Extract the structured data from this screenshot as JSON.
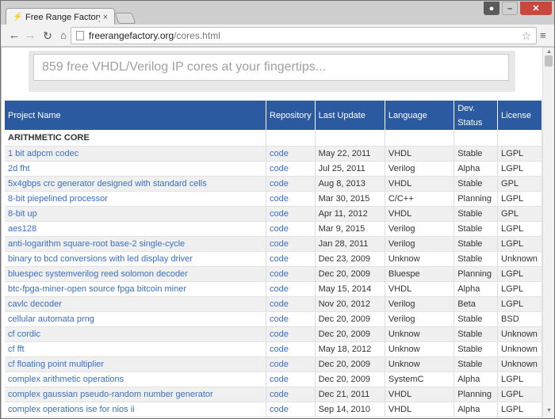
{
  "browser": {
    "tab_title": "Free Range Factory",
    "tab_close": "×",
    "url_host": "freerangefactory.org",
    "url_path": "/cores.html"
  },
  "search": {
    "placeholder": "859 free VHDL/Verilog IP cores at your fingertips..."
  },
  "table": {
    "headers": [
      "Project Name",
      "Repository",
      "Last Update",
      "Language",
      "Dev. Status",
      "License"
    ],
    "group": "ARITHMETIC CORE",
    "rows": [
      {
        "name": "1 bit adpcm codec",
        "repo": "code",
        "date": "May 22, 2011",
        "lang": "VHDL",
        "status": "Stable",
        "license": "LGPL"
      },
      {
        "name": "2d fht",
        "repo": "code",
        "date": "Jul 25, 2011",
        "lang": "Verilog",
        "status": "Alpha",
        "license": "LGPL"
      },
      {
        "name": "5x4gbps crc generator designed with standard cells",
        "repo": "code",
        "date": "Aug 8, 2013",
        "lang": "VHDL",
        "status": "Stable",
        "license": "GPL"
      },
      {
        "name": "8-bit piepelined processor",
        "repo": "code",
        "date": "Mar 30, 2015",
        "lang": "C/C++",
        "status": "Planning",
        "license": "LGPL"
      },
      {
        "name": "8-bit up",
        "repo": "code",
        "date": "Apr 11, 2012",
        "lang": "VHDL",
        "status": "Stable",
        "license": "GPL"
      },
      {
        "name": "aes128",
        "repo": "code",
        "date": "Mar 9, 2015",
        "lang": "Verilog",
        "status": "Stable",
        "license": "LGPL"
      },
      {
        "name": "anti-logarithm square-root base-2 single-cycle",
        "repo": "code",
        "date": "Jan 28, 2011",
        "lang": "Verilog",
        "status": "Stable",
        "license": "LGPL"
      },
      {
        "name": "binary to bcd conversions with led display driver",
        "repo": "code",
        "date": "Dec 23, 2009",
        "lang": "Unknow",
        "status": "Stable",
        "license": "Unknown"
      },
      {
        "name": "bluespec systemverilog reed solomon decoder",
        "repo": "code",
        "date": "Dec 20, 2009",
        "lang": "Bluespe",
        "status": "Planning",
        "license": "LGPL"
      },
      {
        "name": "btc-fpga-miner-open source fpga bitcoin miner",
        "repo": "code",
        "date": "May 15, 2014",
        "lang": "VHDL",
        "status": "Alpha",
        "license": "LGPL"
      },
      {
        "name": "cavlc decoder",
        "repo": "code",
        "date": "Nov 20, 2012",
        "lang": "Verilog",
        "status": "Beta",
        "license": "LGPL"
      },
      {
        "name": "cellular automata prng",
        "repo": "code",
        "date": "Dec 20, 2009",
        "lang": "Verilog",
        "status": "Stable",
        "license": "BSD"
      },
      {
        "name": "cf cordic",
        "repo": "code",
        "date": "Dec 20, 2009",
        "lang": "Unknow",
        "status": "Stable",
        "license": "Unknown"
      },
      {
        "name": "cf fft",
        "repo": "code",
        "date": "May 18, 2012",
        "lang": "Unknow",
        "status": "Stable",
        "license": "Unknown"
      },
      {
        "name": "cf floating point multiplier",
        "repo": "code",
        "date": "Dec 20, 2009",
        "lang": "Unknow",
        "status": "Stable",
        "license": "Unknown"
      },
      {
        "name": "complex arithmetic operations",
        "repo": "code",
        "date": "Dec 20, 2009",
        "lang": "SystemC",
        "status": "Alpha",
        "license": "LGPL"
      },
      {
        "name": "complex gaussian pseudo-random number generator",
        "repo": "code",
        "date": "Dec 21, 2011",
        "lang": "VHDL",
        "status": "Planning",
        "license": "LGPL"
      },
      {
        "name": "complex operations ise for nios ii",
        "repo": "code",
        "date": "Sep 14, 2010",
        "lang": "VHDL",
        "status": "Alpha",
        "license": "LGPL"
      }
    ]
  },
  "colors": {
    "header_bg": "#2c5aa0",
    "link": "#3a6fc4",
    "stripe": "#f0f0f0"
  }
}
